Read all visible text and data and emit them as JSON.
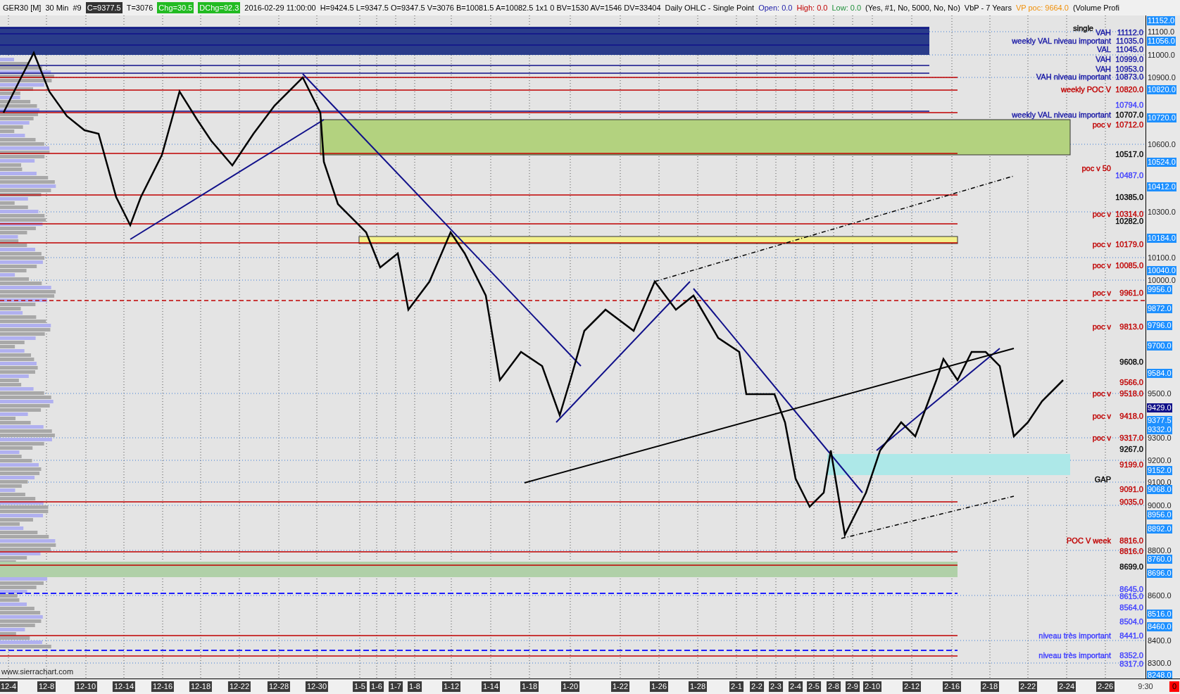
{
  "header": [
    {
      "text": "GER30 [M]",
      "kind": "plain"
    },
    {
      "text": "30 Min",
      "kind": "plain"
    },
    {
      "text": "#9",
      "kind": "plain"
    },
    {
      "text": "C=9377.5",
      "kind": "dark"
    },
    {
      "text": "T=3076",
      "kind": "plain"
    },
    {
      "text": "Chg=30.5",
      "kind": "green"
    },
    {
      "text": "DChg=92.3",
      "kind": "green"
    },
    {
      "text": "2016-02-29 11:00:00",
      "kind": "plain"
    },
    {
      "text": "H=9424.5 L=9347.5 O=9347.5 V=3076 B=10081.5 A=10082.5 1x1 0 BV=1530 AV=1546 DV=33404",
      "kind": "plain"
    },
    {
      "text": "Daily OHLC - Single Point",
      "kind": "plain"
    },
    {
      "text": "Open: 0.0",
      "kind": "colored",
      "color": "#1a1aa6"
    },
    {
      "text": "High: 0.0",
      "kind": "colored",
      "color": "#c00000"
    },
    {
      "text": "Low: 0.0",
      "kind": "colored",
      "color": "#1f8f3a"
    },
    {
      "text": "(Yes, #1, No, 5000, No, No)",
      "kind": "plain"
    },
    {
      "text": "VbP - 7 Years",
      "kind": "plain"
    },
    {
      "text": "VP poc: 9664.0",
      "kind": "colored",
      "color": "#f0900a"
    },
    {
      "text": "(Volume Profi",
      "kind": "plain"
    }
  ],
  "annotations": [
    {
      "label": "single",
      "color": "#000000"
    },
    {
      "label": "VAH",
      "value": "11112.0",
      "color": "#1a1aa6"
    },
    {
      "label": "weekly VAL  niveau important",
      "value": "11035.0",
      "color": "#1a1aa6"
    },
    {
      "label": "VAL",
      "value": "11045.0",
      "color": "#1a1aa6"
    },
    {
      "label": "VAH",
      "value": "10999.0",
      "color": "#1a1aa6"
    },
    {
      "label": "VAH",
      "value": "10953.0",
      "color": "#1a1aa6"
    },
    {
      "label": "VAH   niveau important",
      "value": "10873.0",
      "color": "#1a1aa6"
    },
    {
      "label": "weekly POC V",
      "value": "10820.0",
      "color": "#c00000"
    },
    {
      "value": "10794.0",
      "color": "#4040ff"
    },
    {
      "label": "weekly VAL  niveau important",
      "color": "#1a1aa6"
    },
    {
      "value": "10707.0",
      "color": "#000000"
    },
    {
      "label": "poc v",
      "value": "10712.0",
      "color": "#c00000"
    },
    {
      "value": "10517.0",
      "color": "#000000"
    },
    {
      "label": "poc v 50",
      "color": "#c00000"
    },
    {
      "value": "10487.0",
      "color": "#4040ff"
    },
    {
      "value": "10385.0",
      "color": "#000000"
    },
    {
      "label": "poc v",
      "value": "10314.0",
      "color": "#c00000"
    },
    {
      "value": "10282.0",
      "color": "#000000"
    },
    {
      "label": "poc v",
      "value": "10179.0",
      "color": "#c00000"
    },
    {
      "label": "poc v",
      "value": "10085.0",
      "color": "#c00000"
    },
    {
      "label": "poc v",
      "value": "9961.0",
      "color": "#c00000"
    },
    {
      "label": "poc v",
      "value": "9813.0",
      "color": "#c00000"
    },
    {
      "value": "9608.0",
      "color": "#000000"
    },
    {
      "value": "9566.0",
      "color": "#c00000"
    },
    {
      "label": "poc v",
      "value": "9518.0",
      "color": "#c00000"
    },
    {
      "label": "poc v",
      "value": "9418.0",
      "color": "#c00000"
    },
    {
      "label": "poc v",
      "value": "9317.0",
      "color": "#c00000"
    },
    {
      "value": "9267.0",
      "color": "#000000"
    },
    {
      "value": "9199.0",
      "color": "#c00000"
    },
    {
      "label": "GAP",
      "color": "#000000"
    },
    {
      "value": "9091.0",
      "color": "#c00000"
    },
    {
      "value": "9035.0",
      "color": "#c00000"
    },
    {
      "label": "POC V week",
      "value": "8816.0",
      "color": "#c00000"
    },
    {
      "value": "8816.0",
      "color": "#c00000"
    },
    {
      "value": "8699.0",
      "color": "#000000"
    },
    {
      "value": "8645.0",
      "color": "#4040ff"
    },
    {
      "value": "8615.0",
      "color": "#4040ff"
    },
    {
      "value": "8564.0",
      "color": "#4040ff"
    },
    {
      "value": "8504.0",
      "color": "#4040ff"
    },
    {
      "label": "niveau très important",
      "value": "8441.0",
      "color": "#4040ff"
    },
    {
      "label": "niveau très important",
      "value": "8352.0",
      "color": "#4040ff"
    },
    {
      "value": "8317.0",
      "color": "#4040ff"
    }
  ],
  "watermark_site": "www.sierrachart.com",
  "price_axis": {
    "ticks": [
      "11100.0",
      "11000.0",
      "10900.0",
      "10600.0",
      "10300.0",
      "10100.0",
      "10000.0",
      "9500.0",
      "9300.0",
      "9200.0",
      "9100.0",
      "9000.0",
      "8800.0",
      "8600.0",
      "8400.0",
      "8300.0"
    ],
    "markers": [
      {
        "text": "11152.0",
        "kind": "level"
      },
      {
        "text": "11056.0",
        "kind": "level"
      },
      {
        "text": "10820.0",
        "kind": "level"
      },
      {
        "text": "10720.0",
        "kind": "level"
      },
      {
        "text": "10524.0",
        "kind": "level"
      },
      {
        "text": "10412.0",
        "kind": "level"
      },
      {
        "text": "10184.0",
        "kind": "level"
      },
      {
        "text": "10040.0",
        "kind": "level"
      },
      {
        "text": "9956.0",
        "kind": "level"
      },
      {
        "text": "9872.0",
        "kind": "level"
      },
      {
        "text": "9796.0",
        "kind": "level"
      },
      {
        "text": "9700.0",
        "kind": "level"
      },
      {
        "text": "9584.0",
        "kind": "level"
      },
      {
        "text": "9429.0",
        "kind": "last"
      },
      {
        "text": "9377.5",
        "kind": "level"
      },
      {
        "text": "9332.0",
        "kind": "level"
      },
      {
        "text": "9152.0",
        "kind": "level"
      },
      {
        "text": "9068.0",
        "kind": "level"
      },
      {
        "text": "8956.0",
        "kind": "level"
      },
      {
        "text": "8892.0",
        "kind": "level"
      },
      {
        "text": "8760.0",
        "kind": "level"
      },
      {
        "text": "8696.0",
        "kind": "level"
      },
      {
        "text": "8516.0",
        "kind": "level"
      },
      {
        "text": "8460.0",
        "kind": "level"
      },
      {
        "text": "8248.0",
        "kind": "level"
      }
    ]
  },
  "date_axis": [
    {
      "text": "12-4",
      "kind": "date"
    },
    {
      "text": "12-8",
      "kind": "date"
    },
    {
      "text": "12-10",
      "kind": "date"
    },
    {
      "text": "12-14",
      "kind": "date"
    },
    {
      "text": "12-16",
      "kind": "date"
    },
    {
      "text": "12-18",
      "kind": "date"
    },
    {
      "text": "12-22",
      "kind": "date"
    },
    {
      "text": "12-28",
      "kind": "date"
    },
    {
      "text": "12-30",
      "kind": "date"
    },
    {
      "text": "1-5",
      "kind": "date"
    },
    {
      "text": "1-6",
      "kind": "date"
    },
    {
      "text": "1-7",
      "kind": "date"
    },
    {
      "text": "1-8",
      "kind": "date"
    },
    {
      "text": "1-12",
      "kind": "date"
    },
    {
      "text": "1-14",
      "kind": "date"
    },
    {
      "text": "1-18",
      "kind": "date"
    },
    {
      "text": "1-20",
      "kind": "date"
    },
    {
      "text": "1-22",
      "kind": "date"
    },
    {
      "text": "1-26",
      "kind": "date"
    },
    {
      "text": "1-28",
      "kind": "date"
    },
    {
      "text": "2-1",
      "kind": "date"
    },
    {
      "text": "2-2",
      "kind": "date"
    },
    {
      "text": "2-3",
      "kind": "date"
    },
    {
      "text": "2-4",
      "kind": "date"
    },
    {
      "text": "2-5",
      "kind": "date"
    },
    {
      "text": "2-8",
      "kind": "date"
    },
    {
      "text": "2-9",
      "kind": "date"
    },
    {
      "text": "2-10",
      "kind": "date"
    },
    {
      "text": "2-12",
      "kind": "date"
    },
    {
      "text": "2-16",
      "kind": "date"
    },
    {
      "text": "2-18",
      "kind": "date"
    },
    {
      "text": "2-22",
      "kind": "date"
    },
    {
      "text": "2-24",
      "kind": "date"
    },
    {
      "text": "2-26",
      "kind": "date"
    },
    {
      "text": "9:30",
      "kind": "time"
    },
    {
      "text": "0",
      "kind": "alert"
    }
  ]
}
